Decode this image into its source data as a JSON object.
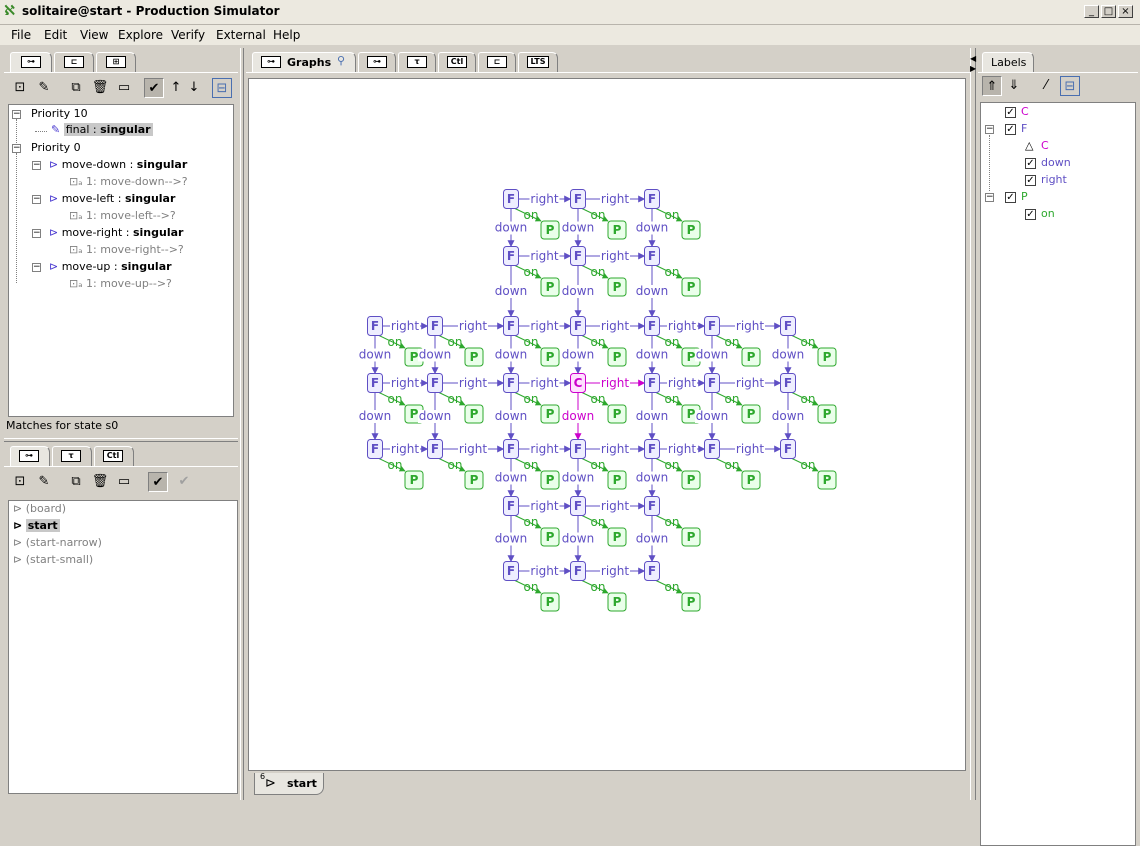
{
  "window": {
    "title": "solitaire@start - Production Simulator",
    "buttons": [
      "_",
      "□",
      "×"
    ]
  },
  "menu": [
    "File",
    "Edit",
    "View",
    "Explore",
    "Verify",
    "External",
    "Help"
  ],
  "colors": {
    "node_f": "#5f4fc4",
    "node_f_fill": "#eeeeff",
    "node_c": "#cc00cc",
    "node_c_fill": "#ffe0ff",
    "node_p": "#2ea82e",
    "node_p_fill": "#eaffea",
    "edge": "#5f4fc4",
    "edge_on": "#2ea82e",
    "edge_c": "#cc00cc"
  },
  "rules_panel": {
    "tabs": [
      "rules-tab",
      "states-tab",
      "table-tab"
    ],
    "toolbar_icons": [
      "new-rule-icon",
      "edit-rule-icon",
      "copy-icon",
      "delete-icon",
      "rename-icon",
      "enable-icon",
      "up-icon",
      "down-icon",
      "collapse-icon"
    ],
    "tree": [
      {
        "label": "Priority 10",
        "children": [
          {
            "name": "final",
            "sep": " : ",
            "kind": "singular",
            "selected": true
          }
        ]
      },
      {
        "label": "Priority 0",
        "children": [
          {
            "name": "move-down",
            "sep": " : ",
            "kind": "singular",
            "match": "1: move-down-->?"
          },
          {
            "name": "move-left",
            "sep": " : ",
            "kind": "singular",
            "match": "1: move-left-->?"
          },
          {
            "name": "move-right",
            "sep": " : ",
            "kind": "singular",
            "match": "1: move-right-->?"
          },
          {
            "name": "move-up",
            "sep": " : ",
            "kind": "singular",
            "match": "1: move-up-->?"
          }
        ]
      }
    ],
    "status": "Matches for state s0"
  },
  "graphs_panel": {
    "tabs": [
      "graph-tab",
      "type-tab",
      "control-tab"
    ],
    "items": [
      {
        "label": "(board)",
        "active": false
      },
      {
        "label": "start",
        "active": true
      },
      {
        "label": "(start-narrow)",
        "active": false
      },
      {
        "label": "(start-small)",
        "active": false
      }
    ]
  },
  "editor": {
    "tabs": [
      {
        "label": "Graphs"
      },
      {
        "label": ""
      },
      {
        "label": ""
      },
      {
        "label": ""
      },
      {
        "label": ""
      },
      {
        "label": "LTS"
      }
    ],
    "bottom_tab": "start",
    "bottom_tab_number": "6"
  },
  "labels_panel": {
    "title": "Labels",
    "tree": [
      {
        "label": "C",
        "color": "#cc00cc",
        "checked": true,
        "level": 0
      },
      {
        "label": "F",
        "color": "#5f4fc4",
        "checked": true,
        "level": 0
      },
      {
        "label": "C",
        "color": "#cc00cc",
        "checked": null,
        "level": 1,
        "supertype": true
      },
      {
        "label": "down",
        "color": "#5f4fc4",
        "checked": true,
        "level": 1
      },
      {
        "label": "right",
        "color": "#5f4fc4",
        "checked": true,
        "level": 1
      },
      {
        "label": "P",
        "color": "#2ea82e",
        "checked": true,
        "level": 0
      },
      {
        "label": "on",
        "color": "#2ea82e",
        "checked": true,
        "level": 1
      }
    ]
  },
  "graph": {
    "node_label_f": "F",
    "node_label_c": "C",
    "node_label_p": "P",
    "edge_right": "right",
    "edge_down": "down",
    "edge_on": "on",
    "rows": [
      {
        "cols": [
          2,
          3,
          4
        ]
      },
      {
        "cols": [
          2,
          3,
          4
        ]
      },
      {
        "cols": [
          0,
          1,
          2,
          3,
          4,
          5,
          6
        ]
      },
      {
        "cols": [
          0,
          1,
          2,
          3,
          4,
          5,
          6
        ]
      },
      {
        "cols": [
          0,
          1,
          2,
          3,
          4,
          5,
          6
        ]
      },
      {
        "cols": [
          2,
          3,
          4
        ]
      },
      {
        "cols": [
          2,
          3,
          4
        ]
      }
    ],
    "center": {
      "row": 3,
      "col": 3
    }
  }
}
